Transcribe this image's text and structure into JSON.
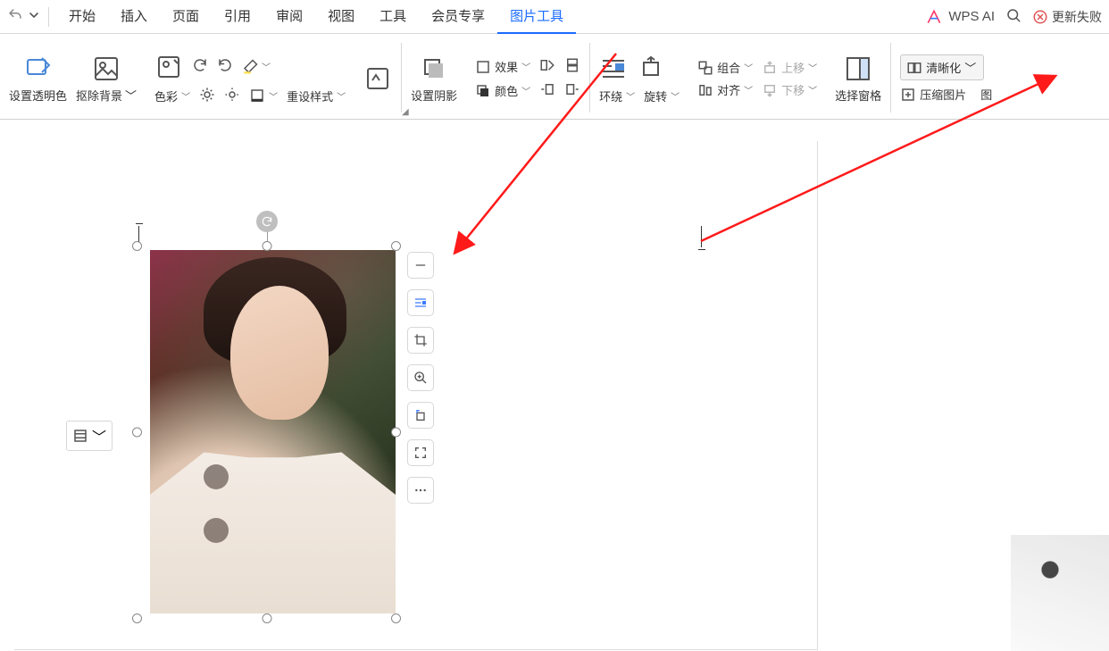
{
  "tabs": {
    "items": [
      "开始",
      "插入",
      "页面",
      "引用",
      "审阅",
      "视图",
      "工具",
      "会员专享",
      "图片工具"
    ],
    "activeIndex": 8,
    "wps_ai": "WPS AI",
    "fail": "更新失败"
  },
  "ribbon": {
    "set_transparent": "设置透明色",
    "remove_bg": "抠除背景",
    "color": "色彩",
    "reset_style": "重设样式",
    "shadow": "设置阴影",
    "effect": "效果",
    "color2": "颜色",
    "wrap": "环绕",
    "rotate": "旋转",
    "group": "组合",
    "align": "对齐",
    "move_up": "上移",
    "move_down": "下移",
    "pane": "选择窗格",
    "enhance": "清晰化",
    "compress": "压缩图片",
    "pic_extra": "图"
  },
  "icons": {
    "remove_minus": "remove-minus",
    "wrap_text": "wrap-text",
    "crop": "crop",
    "zoom": "zoom",
    "rotate_ccw": "rotate-ccw",
    "fullscreen": "fullscreen",
    "more": "more"
  }
}
